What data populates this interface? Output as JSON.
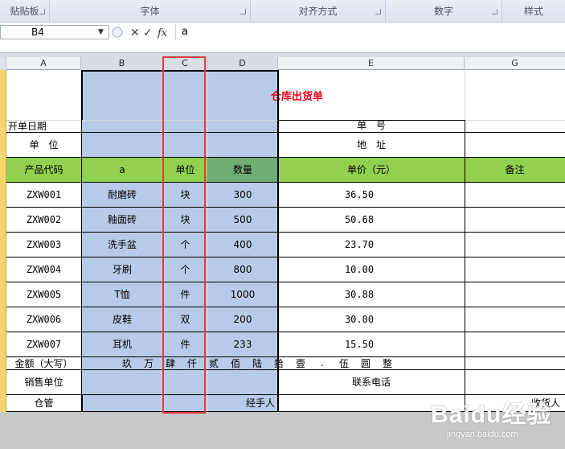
{
  "ribbon": {
    "groups": [
      "贴贴板",
      "字体",
      "对齐方式",
      "数字",
      "样式"
    ]
  },
  "formula_bar": {
    "name_box": "B4",
    "cancel": "✕",
    "enter": "✓",
    "fx": "fx",
    "value": "a"
  },
  "columns": [
    "A",
    "B",
    "C",
    "D",
    "E",
    "G"
  ],
  "sheet": {
    "title": "仓库出货单",
    "date_label": "开单日期",
    "unit_label": "单　位",
    "order_no_label": "单　号",
    "address_label": "地　址",
    "header": {
      "code": "产品代码",
      "name": "a",
      "unit": "单位",
      "qty": "数量",
      "price": "单价（元）",
      "note": "备注"
    },
    "rows": [
      {
        "code": "ZXW001",
        "name": "耐磨砖",
        "unit": "块",
        "qty": "300",
        "price": "36.50"
      },
      {
        "code": "ZXW002",
        "name": "釉面砖",
        "unit": "块",
        "qty": "500",
        "price": "50.68"
      },
      {
        "code": "ZXW003",
        "name": "洗手盆",
        "unit": "个",
        "qty": "400",
        "price": "23.70"
      },
      {
        "code": "ZXW004",
        "name": "牙刷",
        "unit": "个",
        "qty": "800",
        "price": "10.00"
      },
      {
        "code": "ZXW005",
        "name": "T恤",
        "unit": "件",
        "qty": "1000",
        "price": "30.88"
      },
      {
        "code": "ZXW006",
        "name": "皮鞋",
        "unit": "双",
        "qty": "200",
        "price": "30.00"
      },
      {
        "code": "ZXW007",
        "name": "耳机",
        "unit": "件",
        "qty": "233",
        "price": "15.50"
      }
    ],
    "amount_label": "金额（大写）",
    "amount_chars": [
      "玖",
      "万",
      "肆",
      "仟",
      "贰",
      "佰",
      "陆",
      "拾",
      "壹",
      ".",
      "伍",
      "圆",
      "整"
    ],
    "seller_label": "销售单位",
    "phone_label": "联系电话",
    "warehouse_label": "仓管",
    "handler_label": "经手人",
    "receiver_label": "收货人"
  },
  "watermark": {
    "brand": "Baidu经验",
    "url": "jingyan.baidu.com"
  }
}
